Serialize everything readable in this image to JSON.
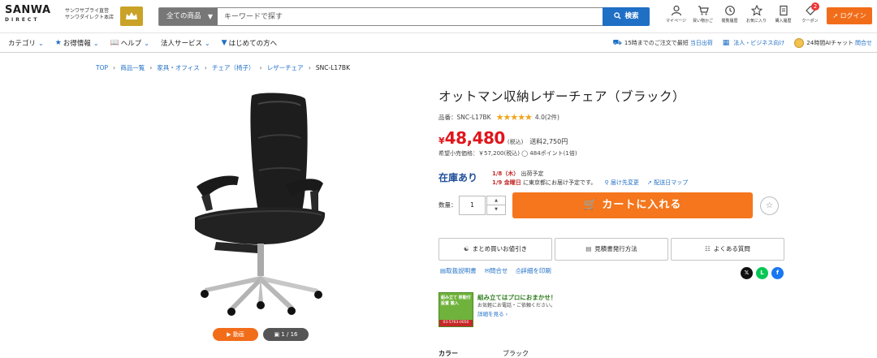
{
  "header": {
    "logo_main": "SANWA",
    "logo_direct": "DIRECT",
    "logo_sub_line1": "サンワサプライ直営",
    "logo_sub_line2": "サンワダイレクト本店",
    "category_select": "全ての商品",
    "search_placeholder": "キーワードで探す",
    "search_button": "検索",
    "icons": [
      {
        "label": "マイページ",
        "icon": "user-icon"
      },
      {
        "label": "買い物かご",
        "icon": "cart-icon"
      },
      {
        "label": "閲覧履歴",
        "icon": "history-icon"
      },
      {
        "label": "お気に入り",
        "icon": "star-icon"
      },
      {
        "label": "購入履歴",
        "icon": "receipt-icon"
      },
      {
        "label": "クーポン",
        "icon": "coupon-icon",
        "badge": "2"
      }
    ],
    "login_button": "ログイン"
  },
  "nav": {
    "items": [
      "カテゴリ",
      "お得情報",
      "ヘルプ",
      "法人サービス",
      "はじめての方へ"
    ],
    "right": {
      "shipping_text": "15時までのご注文で最短",
      "shipping_link": "当日出荷",
      "corporate": "法人・ビジネス向け",
      "chat_text": "24時間AIチャット",
      "chat_link": "問合せ"
    }
  },
  "breadcrumb": [
    "TOP",
    "商品一覧",
    "家具・オフィス",
    "チェア（椅子）",
    "レザーチェア",
    "SNC-L17BK"
  ],
  "product": {
    "title": "オットマン収納レザーチェア（ブラック）",
    "sku_label": "品番：SNC-L17BK",
    "rating_stars": "★★★★★",
    "rating_value": "4.0(2件)",
    "rating": 4.0,
    "price_yen": "¥",
    "price": "48,480",
    "price_tax": "(税込)",
    "shipping": "送料2,750円",
    "msrp": "希望小売価格：￥57,200(税込)",
    "points": "484ポイント(1倍)",
    "stock": "在庫あり",
    "delivery_line1_date": "1/8（木）",
    "delivery_line1_text": "出荷予定",
    "delivery_line2_date": "1/9 金曜日",
    "delivery_line2_text": "に東京都にお届け予定です。",
    "delivery_link1": "届け先変更",
    "delivery_link2": "配送日マップ",
    "qty_label": "数量：",
    "qty_value": "1",
    "cart_button": "カートに入れる",
    "option_buttons": [
      "まとめ買いお値引き",
      "見積書発行方法",
      "よくある質問"
    ],
    "doc_links": [
      "取扱説明書",
      "問合せ",
      "詳細を印刷"
    ],
    "assembly_title": "組み立てはプロにおまかせ！",
    "assembly_sub": "お気軽にお電話・ご依頼ください。",
    "assembly_link": "詳細を見る",
    "assembly_img_text": "組み立て 移動付 設置 搬入",
    "assembly_phone": "03-5763-0050",
    "media_video": "動画",
    "media_count": "1 / 16",
    "spec_label": "カラー",
    "spec_value": "ブラック"
  },
  "colors": {
    "accent_orange": "#f5761c",
    "price_red": "#e0161c",
    "link_blue": "#1f6fc5"
  }
}
